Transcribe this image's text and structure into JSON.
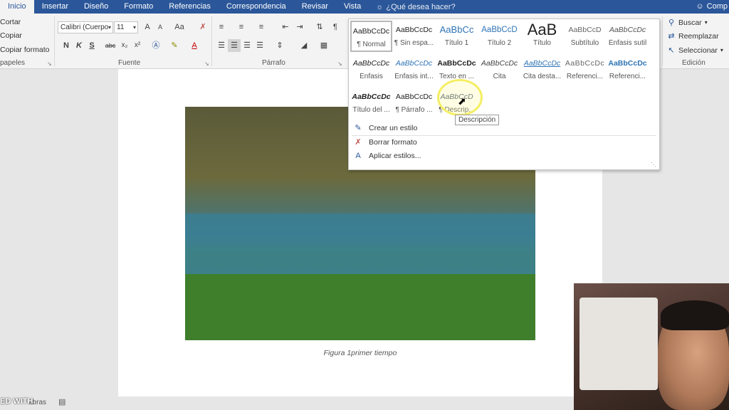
{
  "tabs": [
    "Inicio",
    "Insertar",
    "Diseño",
    "Formato",
    "Referencias",
    "Correspondencia",
    "Revisar",
    "Vista"
  ],
  "tell_me": "¿Qué desea hacer?",
  "share_label": "Comp",
  "clipboard": {
    "cut": "Cortar",
    "copy": "Copiar",
    "format_painter": "Copiar formato",
    "label": "papeles"
  },
  "font": {
    "name": "Calibri (Cuerpo",
    "size": "11",
    "label": "Fuente",
    "change_case": "Aa",
    "grow": "A",
    "shrink": "A",
    "bold": "N",
    "italic": "K",
    "underline": "S",
    "strike": "abc",
    "subscript": "x₂",
    "superscript": "x²"
  },
  "paragraph": {
    "label": "Párrafo",
    "pilcrow": "¶"
  },
  "styles": {
    "row1": [
      {
        "preview": "AaBbCcDc",
        "name": "¶ Normal"
      },
      {
        "preview": "AaBbCcDc",
        "name": "¶ Sin espa..."
      },
      {
        "preview": "AaBbCc",
        "name": "Título 1"
      },
      {
        "preview": "AaBbCcD",
        "name": "Título 2"
      },
      {
        "preview": "AaB",
        "name": "Título"
      },
      {
        "preview": "AaBbCcD",
        "name": "Subtítulo"
      },
      {
        "preview": "AaBbCcDc",
        "name": "Énfasis sutil"
      }
    ],
    "row2": [
      {
        "preview": "AaBbCcDc",
        "name": "Énfasis"
      },
      {
        "preview": "AaBbCcDc",
        "name": "Énfasis int..."
      },
      {
        "preview": "AaBbCcDc",
        "name": "Texto en ..."
      },
      {
        "preview": "AaBbCcDc",
        "name": "Cita"
      },
      {
        "preview": "AaBbCcDc",
        "name": "Cita desta..."
      },
      {
        "preview": "AaBbCcDc",
        "name": "Referenci..."
      },
      {
        "preview": "AaBbCcDc",
        "name": "Referenci..."
      }
    ],
    "row3": [
      {
        "preview": "AaBbCcDc",
        "name": "Título del ..."
      },
      {
        "preview": "AaBbCcDc",
        "name": "¶ Párrafo ..."
      },
      {
        "preview": "AaBbCcD",
        "name": "¶ Descrip..."
      }
    ],
    "actions": [
      "Crear un estilo",
      "Borrar formato",
      "Aplicar estilos..."
    ],
    "tooltip": "Descripción"
  },
  "editing": {
    "find": "Buscar",
    "replace": "Reemplazar",
    "select": "Seleccionar",
    "label": "Edición"
  },
  "document": {
    "caption": "Figura 1primer tiempo"
  },
  "status": {
    "watermark": "ED WITH",
    "words": "abras"
  },
  "colors": {
    "accent": "#2b579a",
    "highlight": "#f5ee63"
  }
}
